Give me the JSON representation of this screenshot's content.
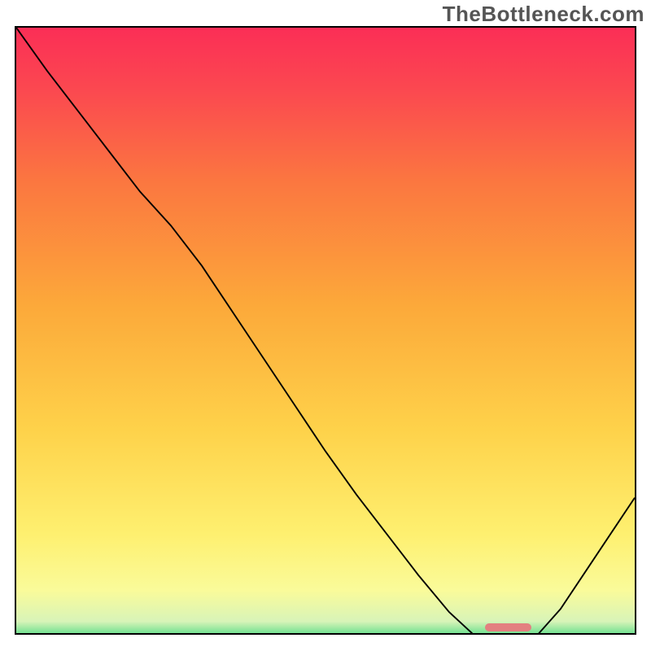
{
  "watermark": "TheBottleneck.com",
  "chart_data": {
    "type": "line",
    "title": "",
    "xlabel": "",
    "ylabel": "",
    "xlim": [
      0,
      1
    ],
    "ylim": [
      0,
      1
    ],
    "background_gradient_stops": [
      {
        "offset": 0.0,
        "color": "#20d060"
      },
      {
        "offset": 0.02,
        "color": "#70e090"
      },
      {
        "offset": 0.04,
        "color": "#d8f4b8"
      },
      {
        "offset": 0.09,
        "color": "#fafb9a"
      },
      {
        "offset": 0.18,
        "color": "#fef070"
      },
      {
        "offset": 0.35,
        "color": "#fed24a"
      },
      {
        "offset": 0.55,
        "color": "#fca93a"
      },
      {
        "offset": 0.75,
        "color": "#fb7740"
      },
      {
        "offset": 0.9,
        "color": "#fb4850"
      },
      {
        "offset": 1.0,
        "color": "#fb2e56"
      }
    ],
    "series": [
      {
        "name": "bottleneck-curve",
        "color": "#000000",
        "width": 2.5,
        "x": [
          0.0,
          0.05,
          0.1,
          0.15,
          0.2,
          0.25,
          0.3,
          0.35,
          0.4,
          0.45,
          0.5,
          0.55,
          0.6,
          0.65,
          0.7,
          0.74,
          0.78,
          0.81,
          0.84,
          0.88,
          0.92,
          0.96,
          1.0
        ],
        "y": [
          1.0,
          0.93,
          0.865,
          0.8,
          0.735,
          0.68,
          0.615,
          0.54,
          0.465,
          0.39,
          0.315,
          0.245,
          0.18,
          0.115,
          0.055,
          0.018,
          0.002,
          0.002,
          0.015,
          0.06,
          0.12,
          0.18,
          0.24
        ]
      }
    ],
    "marker": {
      "name": "optimal-zone",
      "x_center": 0.795,
      "y": 0.01,
      "width_frac": 0.075,
      "color": "#e38080"
    },
    "legend": null
  }
}
